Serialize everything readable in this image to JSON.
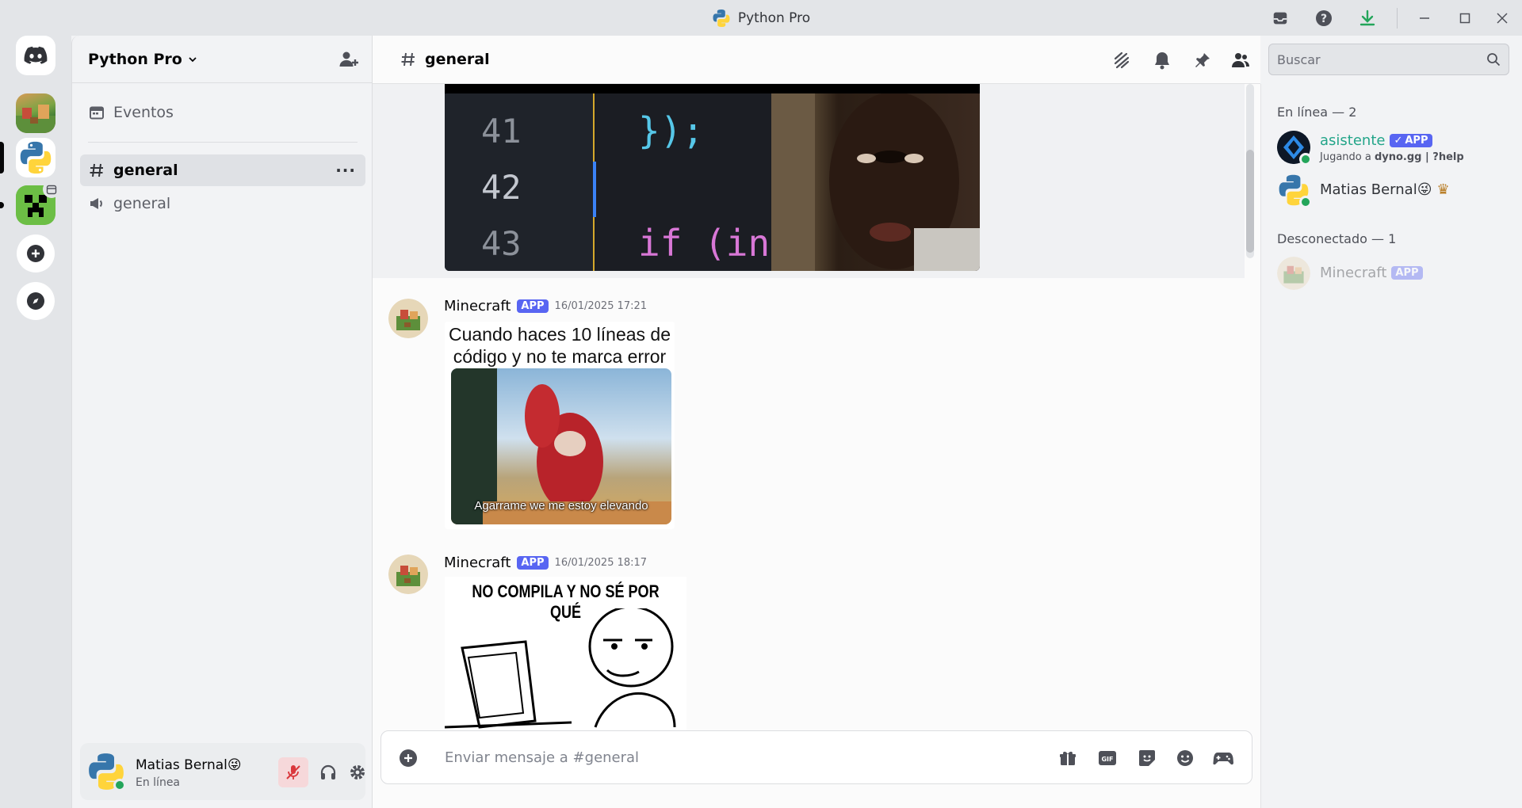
{
  "window": {
    "title": "Python Pro"
  },
  "server": {
    "name": "Python Pro"
  },
  "sidebar": {
    "events_label": "Eventos",
    "channels": [
      {
        "name": "general",
        "type": "text"
      },
      {
        "name": "general",
        "type": "announcement"
      }
    ]
  },
  "user": {
    "name": "Matias Bernal😜",
    "status": "En línea"
  },
  "channel_header": {
    "name": "general"
  },
  "search": {
    "placeholder": "Buscar"
  },
  "messages": [
    {
      "author": "Minecraft",
      "badge": "APP",
      "timestamp": "16/01/2025 17:21",
      "meme_caption_top": "Cuando haces 10 líneas de código y no te marca error",
      "meme_caption_bottom": "Agarrame we me estoy elevando"
    },
    {
      "author": "Minecraft",
      "badge": "APP",
      "timestamp": "16/01/2025 18:17",
      "meme_caption_top": "NO COMPILA  Y NO SÉ POR QUÉ"
    }
  ],
  "code_image": {
    "lines": [
      {
        "num": "41",
        "code": "});"
      },
      {
        "num": "42",
        "code": ""
      },
      {
        "num": "43",
        "code": "if (in"
      }
    ]
  },
  "composer": {
    "placeholder": "Enviar mensaje a #general"
  },
  "members": {
    "online_header": "En línea — 2",
    "offline_header": "Desconectado — 1",
    "online": [
      {
        "name": "asistente",
        "badge": "APP",
        "activity_prefix": "Jugando a ",
        "activity": "dyno.gg | ?help"
      },
      {
        "name": "Matias Bernal😜",
        "crown": "♛"
      }
    ],
    "offline": [
      {
        "name": "Minecraft",
        "badge": "APP"
      }
    ]
  }
}
